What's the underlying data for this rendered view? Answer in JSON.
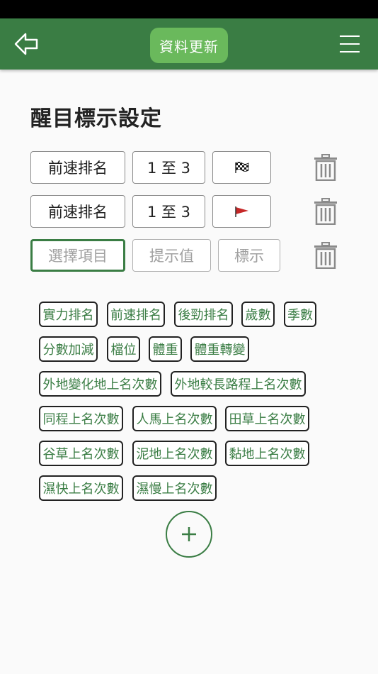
{
  "header": {
    "update_label": "資料更新"
  },
  "page": {
    "title": "醒目標示設定"
  },
  "rules": [
    {
      "item": "前速排名",
      "value": "1 至 3",
      "marker_icon": "checkered-flag-icon"
    },
    {
      "item": "前速排名",
      "value": "1 至 3",
      "marker_icon": "red-flag-icon"
    }
  ],
  "new_rule": {
    "item_placeholder": "選擇項目",
    "value_placeholder": "提示值",
    "marker_placeholder": "標示"
  },
  "tags": [
    "實力排名",
    "前速排名",
    "後勁排名",
    "歲數",
    "季數",
    "分數加減",
    "檔位",
    "體重",
    "體重轉變",
    "外地變化地上名次數",
    "外地較長路程上名次數",
    "同程上名次數",
    "人馬上名次數",
    "田草上名次數",
    "谷草上名次數",
    "泥地上名次數",
    "黏地上名次數",
    "濕快上名次數",
    "濕慢上名次數"
  ],
  "colors": {
    "primary": "#3a7d44",
    "accent": "#6ab95c",
    "flag_red": "#c62828"
  }
}
